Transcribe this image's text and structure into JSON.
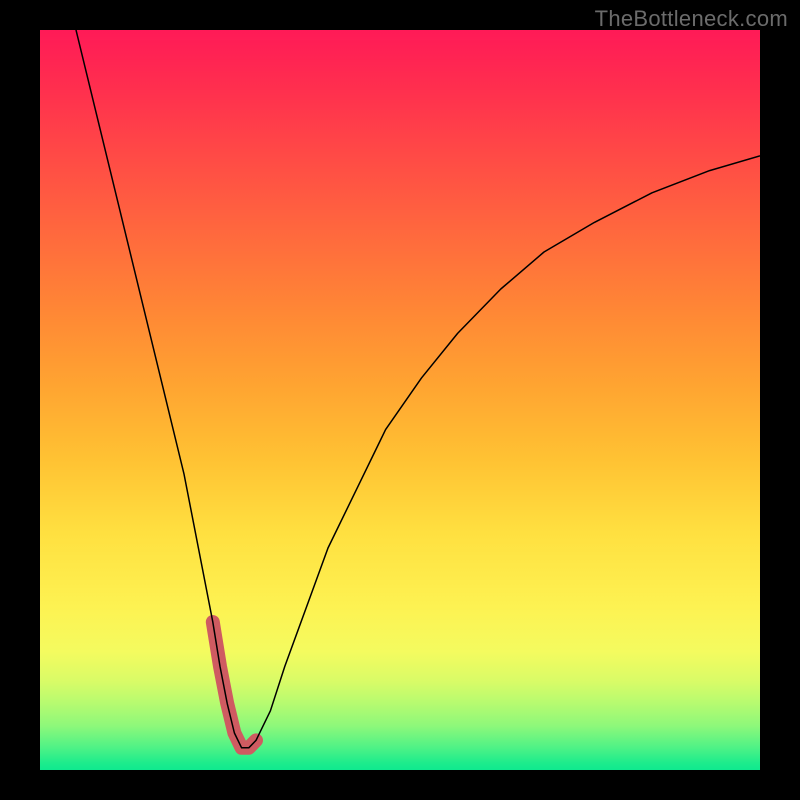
{
  "watermark": "TheBottleneck.com",
  "chart_data": {
    "type": "line",
    "title": "",
    "xlabel": "",
    "ylabel": "",
    "xlim": [
      0,
      100
    ],
    "ylim": [
      0,
      100
    ],
    "series": [
      {
        "name": "bottleneck-curve",
        "x": [
          5,
          8,
          11,
          14,
          17,
          20,
          22,
          24,
          25,
          26,
          27,
          28,
          29,
          30,
          32,
          34,
          37,
          40,
          44,
          48,
          53,
          58,
          64,
          70,
          77,
          85,
          93,
          100
        ],
        "y": [
          100,
          88,
          76,
          64,
          52,
          40,
          30,
          20,
          14,
          9,
          5,
          3,
          3,
          4,
          8,
          14,
          22,
          30,
          38,
          46,
          53,
          59,
          65,
          70,
          74,
          78,
          81,
          83
        ]
      }
    ],
    "marker_segment": {
      "name": "minimum-highlight",
      "x": [
        24,
        25,
        26,
        27,
        28,
        29,
        30
      ],
      "y": [
        20,
        14,
        9,
        5,
        3,
        3,
        4
      ]
    },
    "colors": {
      "curve": "#000000",
      "marker": "#cf5b61",
      "background_gradient_top": "#ff1a57",
      "background_gradient_bottom": "#0fe98f"
    }
  }
}
